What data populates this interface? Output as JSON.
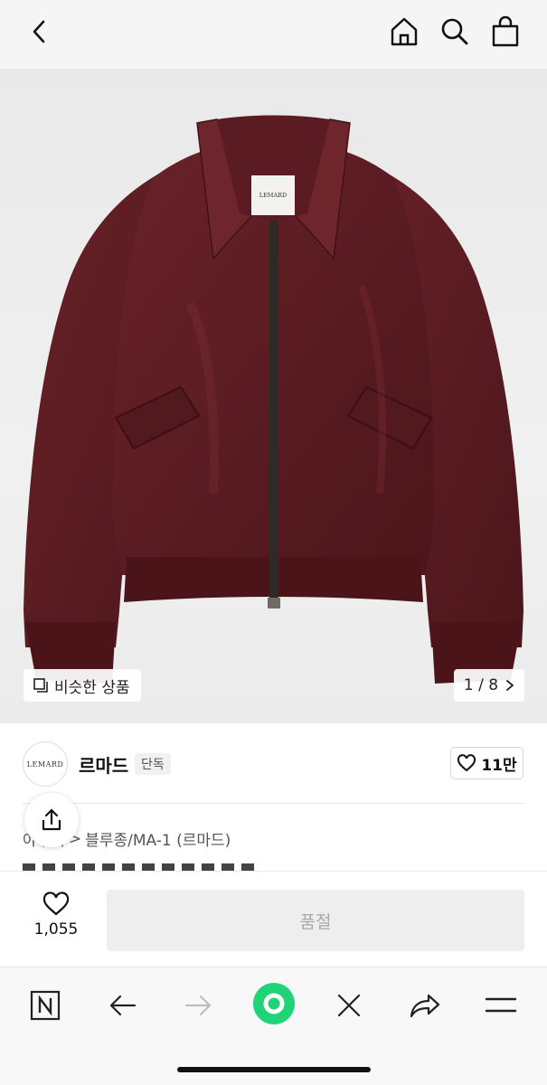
{
  "topbar": {
    "back_icon": "chevron-left-icon",
    "home_icon": "home-icon",
    "search_icon": "search-icon",
    "bag_icon": "shopping-bag-icon"
  },
  "hero": {
    "image_alt": "burgundy bomber jacket",
    "label_text": "LEMARD",
    "similar_label": "비슷한 상품",
    "counter": "1 / 8"
  },
  "brand": {
    "logo_text": "LEMARD",
    "name": "르마드",
    "badge": "단독",
    "like_count": "11만"
  },
  "category": {
    "partial": "아우터",
    "sep": ">",
    "item": "블루종/MA-1 (르마드)"
  },
  "buybar": {
    "wish_count": "1,055",
    "soldout_label": "품절"
  },
  "browser": {
    "icons": [
      "naver-icon",
      "back-arrow-icon",
      "forward-arrow-icon",
      "green-dot-icon",
      "close-icon",
      "share-icon",
      "menu-icon"
    ]
  },
  "colors": {
    "jacket": "#5e1e24",
    "jacket_shadow": "#3f1217",
    "green": "#1ed477",
    "soldout_bg": "#eeeeee"
  }
}
